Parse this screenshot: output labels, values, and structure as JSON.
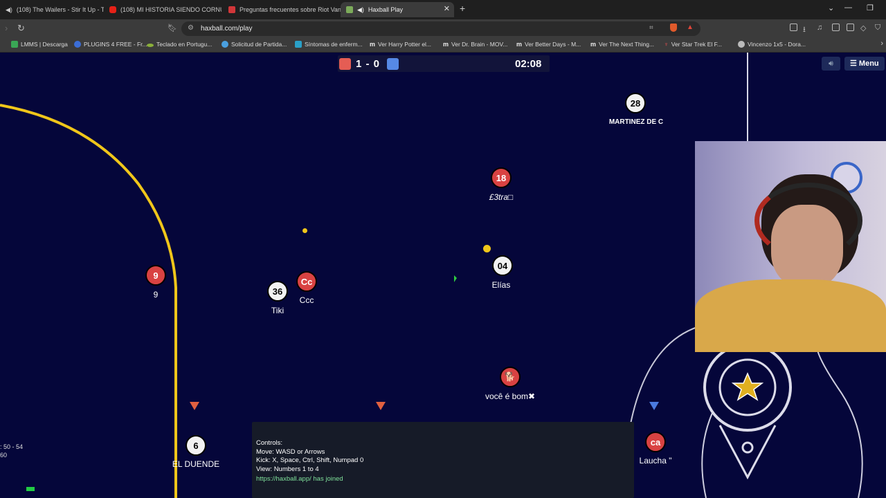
{
  "browser": {
    "tabs": [
      {
        "title": "(108) The Wailers - Stir It Up - Th",
        "favicon": "youtube-icon"
      },
      {
        "title": "(108) MI HISTORIA SIENDO CORNUD",
        "favicon": "youtube-icon"
      },
      {
        "title": "Preguntas frecuentes sobre Riot Vang",
        "favicon": "riot-icon"
      },
      {
        "title": "Haxball Play",
        "favicon": "haxball-icon",
        "active": true
      }
    ],
    "new_tab_label": "+",
    "url": "haxball.com/play",
    "bookmarks": [
      "LMMS | Descarga",
      "PLUGINS 4 FREE - Fr...",
      "Teclado en Portugu...",
      "Solicitud de Partida...",
      "Síntomas de enferm...",
      "Ver Harry Potter el...",
      "Ver Dr. Brain - MOV...",
      "Ver Better Days - M...",
      "Ver The Next Thing...",
      "Ver Star Trek El F...",
      "Vincenzo 1x5 - Dora..."
    ]
  },
  "game": {
    "score": "1 - 0",
    "timer": "02:08",
    "red_color": "#e55d54",
    "blue_color": "#5689e5",
    "menu_label": "Menu",
    "players": [
      {
        "id": "p-martinez",
        "label": "28",
        "name": "MARTINEZ DE C",
        "team": "white"
      },
      {
        "id": "p-l3tra",
        "label": "18",
        "name": "£3tra□",
        "team": "red"
      },
      {
        "id": "p-elias",
        "label": "04",
        "name": "Elías",
        "team": "white"
      },
      {
        "id": "p-9",
        "label": "9",
        "name": "9",
        "team": "red"
      },
      {
        "id": "p-tiki",
        "label": "36",
        "name": "Tiki",
        "team": "white"
      },
      {
        "id": "p-ccc",
        "label": "Cc",
        "name": "Ccc",
        "team": "red"
      },
      {
        "id": "p-voce",
        "label": "🐕",
        "name": "você é bom✖",
        "team": "red"
      },
      {
        "id": "p-duende",
        "label": "6",
        "name": "EL DUENDE",
        "team": "white"
      },
      {
        "id": "p-laucha",
        "label": "ca",
        "name": "Laucha \"",
        "team": "red"
      }
    ],
    "chat": [
      {
        "text": "Controls:",
        "type": "normal"
      },
      {
        "text": "Move: WASD or Arrows",
        "type": "normal"
      },
      {
        "text": "Kick: X, Space, Ctrl, Shift, Numpad 0",
        "type": "normal"
      },
      {
        "text": "View: Numbers 1 to 4",
        "type": "normal"
      },
      {
        "text": "https://haxball.app/ has joined",
        "type": "link"
      }
    ],
    "stats_line1": ": 50 - 54",
    "stats_line2": "60"
  }
}
